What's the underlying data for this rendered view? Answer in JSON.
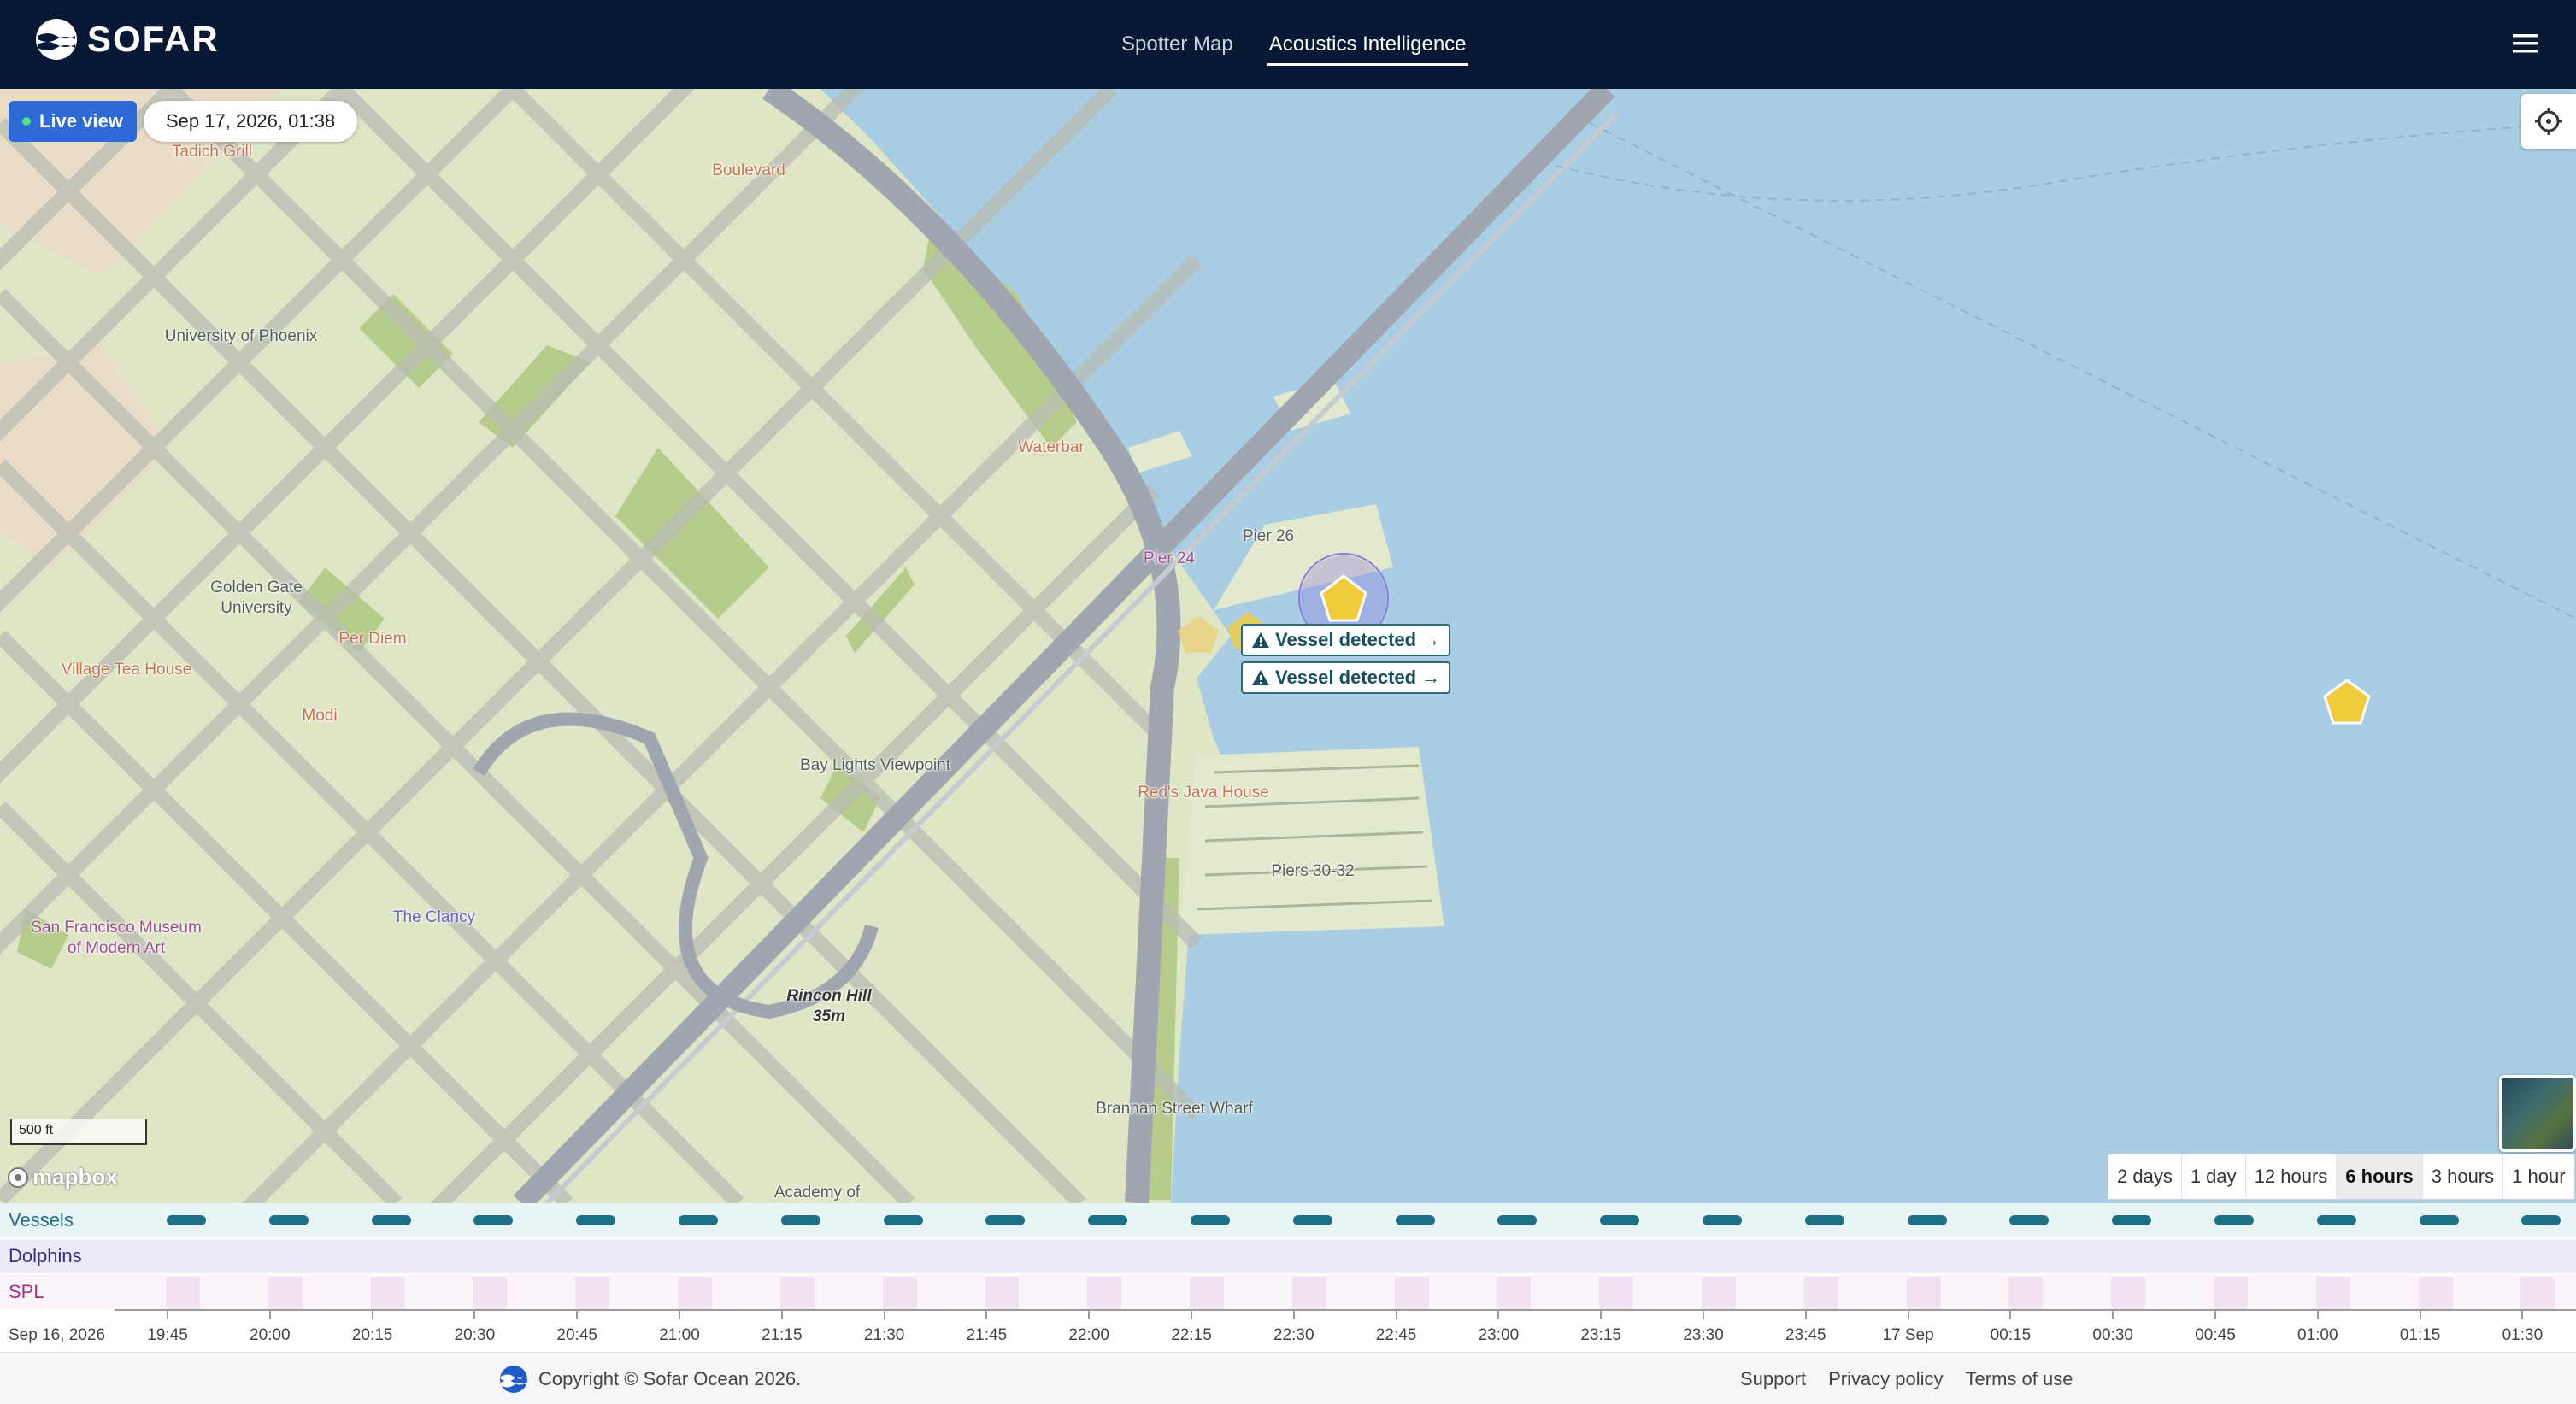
{
  "header": {
    "brand": "SOFAR",
    "tabs": [
      {
        "label": "Spotter Map",
        "active": false
      },
      {
        "label": "Acoustics Intelligence",
        "active": true
      }
    ],
    "menu_icon": "hamburger-icon"
  },
  "map": {
    "live_view_label": "Live view",
    "datetime": "Sep 17, 2026, 01:38",
    "locate_icon": "crosshair-icon",
    "vessel_detections": [
      {
        "label": "Vessel detected"
      },
      {
        "label": "Vessel detected"
      }
    ],
    "labels": {
      "tadich": "Tadich Grill",
      "boulevard": "Boulevard",
      "univ_phoenix": "University of Phoenix",
      "waterbar": "Waterbar",
      "pier24": "Pier 24",
      "pier26": "Pier 26",
      "golden_gate_1": "Golden Gate",
      "golden_gate_2": "University",
      "per_diem": "Per Diem",
      "village_tea": "Village Tea House",
      "modi": "Modi",
      "bay_lights": "Bay Lights Viewpoint",
      "reds": "Red's Java House",
      "piers_30": "Piers 30-32",
      "sfmoma_1": "San Francisco Museum",
      "sfmoma_2": "of Modern Art",
      "clancy": "The Clancy",
      "rincon_1": "Rincon Hill",
      "rincon_2": "35m",
      "brannan": "Brannan Street Wharf",
      "academy": "Academy of"
    },
    "scale_label": "500 ft",
    "attribution": "mapbox",
    "basemap_toggle": "satellite-thumbnail",
    "time_ranges": [
      {
        "label": "2 days",
        "active": false
      },
      {
        "label": "1 day",
        "active": false
      },
      {
        "label": "12 hours",
        "active": false
      },
      {
        "label": "6 hours",
        "active": true
      },
      {
        "label": "3 hours",
        "active": false
      },
      {
        "label": "1 hour",
        "active": false
      }
    ],
    "colors": {
      "water": "#a9cde3",
      "land": "#dfe6c6",
      "vessel_marker": "#f0cc3c",
      "accent": "#2d6ad6"
    }
  },
  "timeline": {
    "rows": [
      {
        "label": "Vessels",
        "color": "#1f6f86"
      },
      {
        "label": "Dolphins",
        "color": "#3b2a8a"
      },
      {
        "label": "SPL",
        "color": "#a0308c"
      }
    ],
    "start_date": "Sep 16, 2026",
    "ticks": [
      "19:45",
      "20:00",
      "20:15",
      "20:30",
      "20:45",
      "21:00",
      "21:15",
      "21:30",
      "21:45",
      "22:00",
      "22:15",
      "22:30",
      "22:45",
      "23:00",
      "23:15",
      "23:30",
      "23:45",
      "17 Sep",
      "00:15",
      "00:30",
      "00:45",
      "01:00",
      "01:15",
      "01:30"
    ]
  },
  "footer": {
    "copyright": "Copyright © Sofar Ocean 2026.",
    "links": [
      "Support",
      "Privacy policy",
      "Terms of use"
    ]
  }
}
